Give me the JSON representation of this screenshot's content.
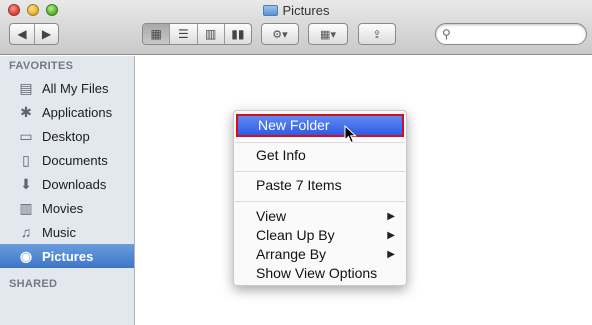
{
  "window": {
    "title": "Pictures"
  },
  "toolbar": {
    "back_icon": "chevron-left-icon",
    "forward_icon": "chevron-right-icon",
    "view_modes": [
      "icon-view-icon",
      "list-view-icon",
      "column-view-icon",
      "coverflow-view-icon"
    ],
    "active_view": "icon-view-icon",
    "action_icon": "gear-icon",
    "arrange_icon": "arrange-icon",
    "share_icon": "share-icon",
    "search_placeholder": ""
  },
  "sidebar": {
    "favorites_title": "FAVORITES",
    "shared_title": "SHARED",
    "items": [
      {
        "label": "All My Files",
        "icon": "all-files-icon",
        "glyph": "▤"
      },
      {
        "label": "Applications",
        "icon": "applications-icon",
        "glyph": "✱"
      },
      {
        "label": "Desktop",
        "icon": "desktop-icon",
        "glyph": "▭"
      },
      {
        "label": "Documents",
        "icon": "documents-icon",
        "glyph": "▯"
      },
      {
        "label": "Downloads",
        "icon": "downloads-icon",
        "glyph": "⬇"
      },
      {
        "label": "Movies",
        "icon": "movies-icon",
        "glyph": "▥"
      },
      {
        "label": "Music",
        "icon": "music-icon",
        "glyph": "♫"
      },
      {
        "label": "Pictures",
        "icon": "camera-icon",
        "glyph": "◉",
        "selected": true
      }
    ]
  },
  "context_menu": {
    "items": [
      {
        "label": "New Folder",
        "highlighted": true
      },
      {
        "label": "Get Info"
      },
      {
        "label": "Paste 7 Items"
      },
      {
        "label": "View",
        "submenu": true
      },
      {
        "label": "Clean Up By",
        "submenu": true
      },
      {
        "label": "Arrange By",
        "submenu": true
      },
      {
        "label": "Show View Options"
      }
    ]
  },
  "colors": {
    "selection_blue": "#3e76c7",
    "menu_highlight": "#2f5be6",
    "highlight_outline": "#d0101d"
  }
}
